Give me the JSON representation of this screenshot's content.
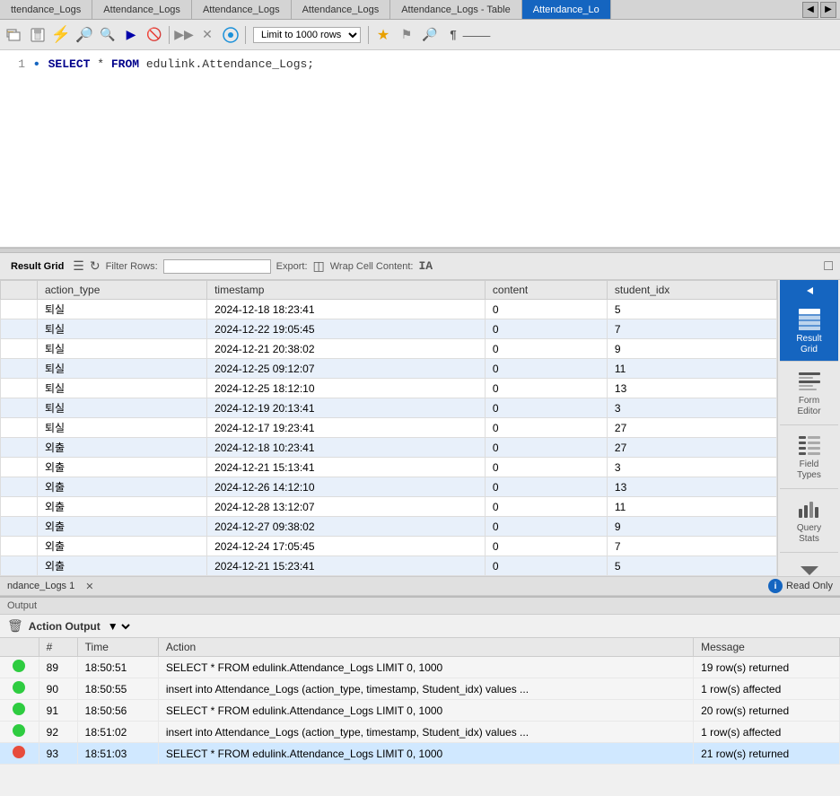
{
  "tabs": [
    {
      "label": "ttendance_Logs",
      "active": false
    },
    {
      "label": "Attendance_Logs",
      "active": false
    },
    {
      "label": "Attendance_Logs",
      "active": false
    },
    {
      "label": "Attendance_Logs",
      "active": false
    },
    {
      "label": "Attendance_Logs - Table",
      "active": false
    },
    {
      "label": "Attendance_Lo",
      "active": true
    }
  ],
  "toolbar": {
    "limit_label": "Limit to 1000 rows"
  },
  "sql": {
    "line_number": "1",
    "query": "SELECT * FROM edulink.Attendance_Logs;"
  },
  "result_toolbar": {
    "result_grid_label": "Result Grid",
    "filter_label": "Filter Rows:",
    "export_label": "Export:",
    "wrap_label": "Wrap Cell Content:",
    "wrap_icon": "IA"
  },
  "columns": [
    "action_type",
    "timestamp",
    "content",
    "student_idx"
  ],
  "rows": [
    {
      "action_type": "퇴실",
      "timestamp": "2024-12-18 18:23:41",
      "content": "0",
      "student_idx": "5"
    },
    {
      "action_type": "퇴실",
      "timestamp": "2024-12-22 19:05:45",
      "content": "0",
      "student_idx": "7"
    },
    {
      "action_type": "퇴실",
      "timestamp": "2024-12-21 20:38:02",
      "content": "0",
      "student_idx": "9"
    },
    {
      "action_type": "퇴실",
      "timestamp": "2024-12-25 09:12:07",
      "content": "0",
      "student_idx": "11"
    },
    {
      "action_type": "퇴실",
      "timestamp": "2024-12-25 18:12:10",
      "content": "0",
      "student_idx": "13"
    },
    {
      "action_type": "퇴실",
      "timestamp": "2024-12-19 20:13:41",
      "content": "0",
      "student_idx": "3"
    },
    {
      "action_type": "퇴실",
      "timestamp": "2024-12-17 19:23:41",
      "content": "0",
      "student_idx": "27"
    },
    {
      "action_type": "외출",
      "timestamp": "2024-12-18 10:23:41",
      "content": "0",
      "student_idx": "27"
    },
    {
      "action_type": "외출",
      "timestamp": "2024-12-21 15:13:41",
      "content": "0",
      "student_idx": "3"
    },
    {
      "action_type": "외출",
      "timestamp": "2024-12-26 14:12:10",
      "content": "0",
      "student_idx": "13"
    },
    {
      "action_type": "외출",
      "timestamp": "2024-12-28 13:12:07",
      "content": "0",
      "student_idx": "11"
    },
    {
      "action_type": "외출",
      "timestamp": "2024-12-27 09:38:02",
      "content": "0",
      "student_idx": "9"
    },
    {
      "action_type": "외출",
      "timestamp": "2024-12-24 17:05:45",
      "content": "0",
      "student_idx": "7"
    },
    {
      "action_type": "외출",
      "timestamp": "2024-12-21 15:23:41",
      "content": "0",
      "student_idx": "5"
    }
  ],
  "sidebar_items": [
    {
      "label": "Result\nGrid",
      "active": true
    },
    {
      "label": "Form\nEditor",
      "active": false
    },
    {
      "label": "Field\nTypes",
      "active": false
    },
    {
      "label": "Query\nStats",
      "active": false
    }
  ],
  "status_bar": {
    "tab_label": "ndance_Logs 1",
    "readonly_label": "Read Only"
  },
  "output": {
    "header": "Output",
    "dropdown_label": "Action Output",
    "columns": [
      "#",
      "Time",
      "Action",
      "Message"
    ],
    "rows": [
      {
        "num": "89",
        "time": "18:50:51",
        "action": "SELECT * FROM edulink.Attendance_Logs LIMIT 0, 1000",
        "message": "19 row(s) returned",
        "status": "green"
      },
      {
        "num": "90",
        "time": "18:50:55",
        "action": "insert into Attendance_Logs (action_type, timestamp, Student_idx) values ...",
        "message": "1 row(s) affected",
        "status": "green"
      },
      {
        "num": "91",
        "time": "18:50:56",
        "action": "SELECT * FROM edulink.Attendance_Logs LIMIT 0, 1000",
        "message": "20 row(s) returned",
        "status": "green"
      },
      {
        "num": "92",
        "time": "18:51:02",
        "action": "insert into Attendance_Logs (action_type, timestamp, Student_idx) values ...",
        "message": "1 row(s) affected",
        "status": "green"
      },
      {
        "num": "93",
        "time": "18:51:03",
        "action": "SELECT * FROM edulink.Attendance_Logs LIMIT 0, 1000",
        "message": "21 row(s) returned",
        "status": "red"
      }
    ]
  }
}
